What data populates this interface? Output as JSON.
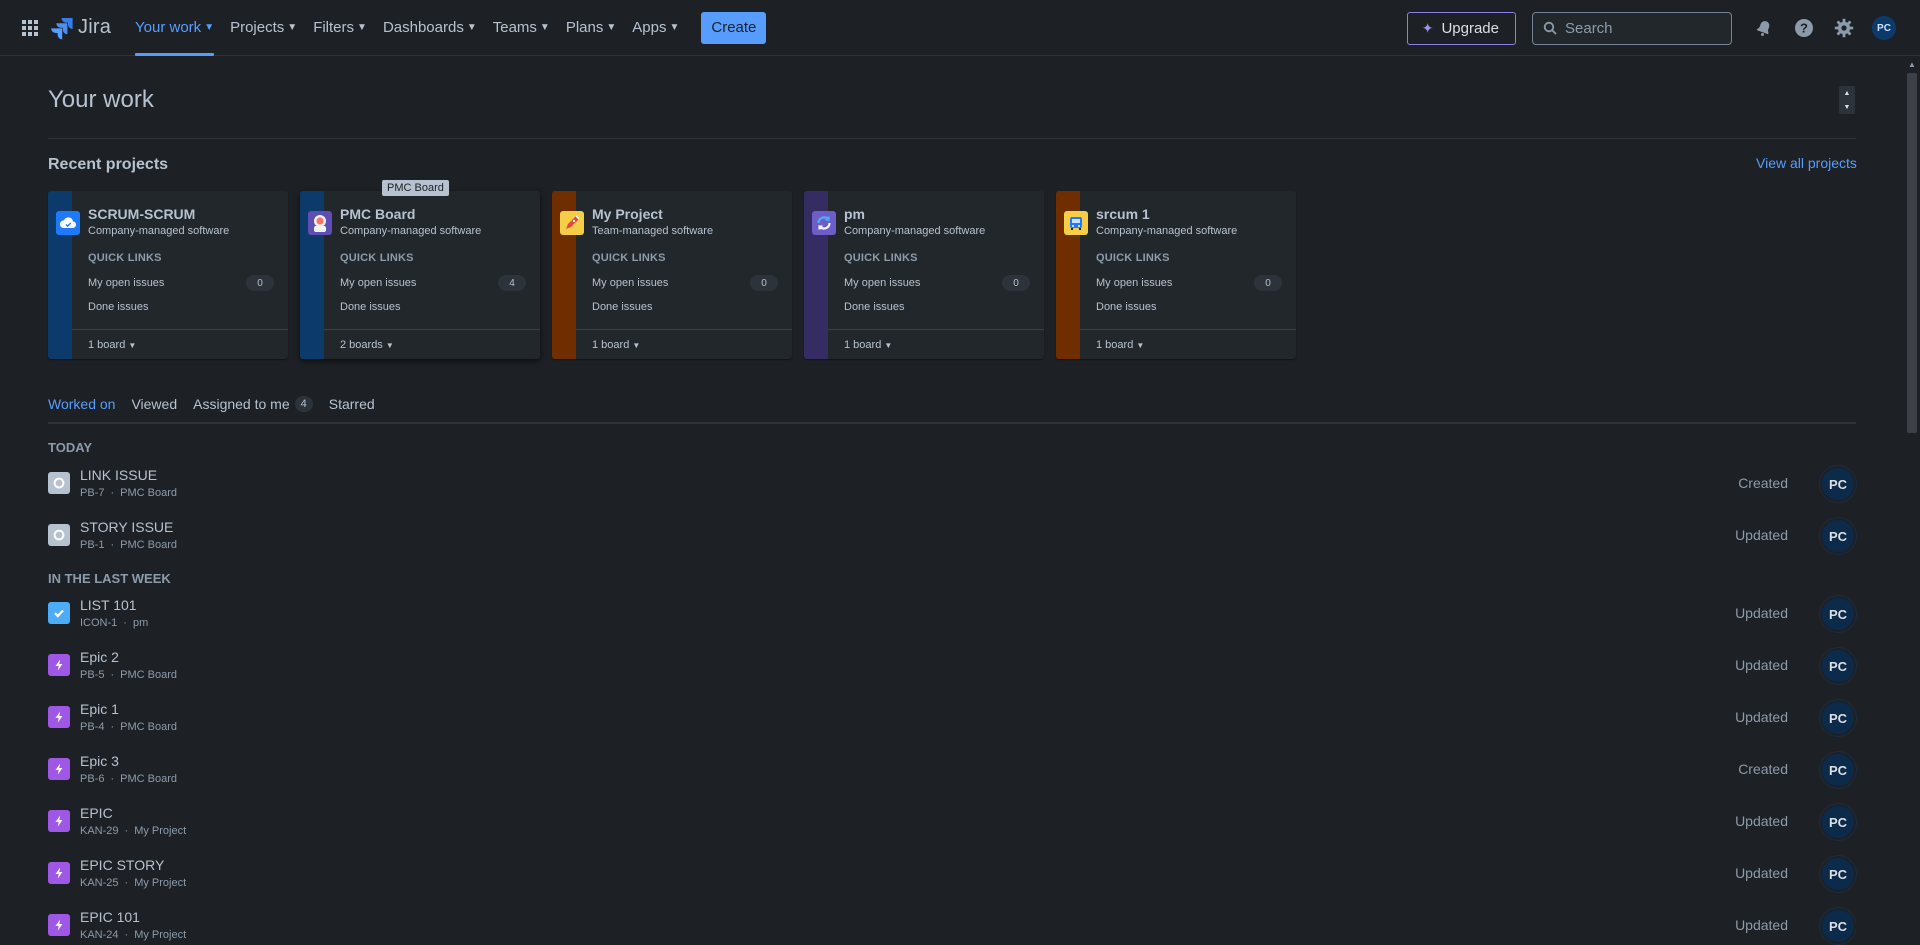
{
  "app": {
    "name": "Jira"
  },
  "nav": {
    "items": [
      {
        "label": "Your work",
        "active": true
      },
      {
        "label": "Projects"
      },
      {
        "label": "Filters"
      },
      {
        "label": "Dashboards"
      },
      {
        "label": "Teams"
      },
      {
        "label": "Plans"
      },
      {
        "label": "Apps"
      }
    ],
    "create_label": "Create",
    "upgrade_label": "Upgrade",
    "search_placeholder": "Search",
    "user_initials": "PC"
  },
  "page": {
    "title": "Your work",
    "recent_projects_heading": "Recent projects",
    "view_all_label": "View all projects",
    "tooltip": "PMC Board"
  },
  "projects": [
    {
      "name": "SCRUM-SCRUM",
      "type": "Company-managed software",
      "quick_links": "QUICK LINKS",
      "open_issues_label": "My open issues",
      "open_count": "0",
      "done_label": "Done issues",
      "boards": "1 board",
      "bar_color": "#0c3a6b",
      "icon": "cloud-icon",
      "icon_bg": "#1d7afc"
    },
    {
      "name": "PMC Board",
      "type": "Company-managed software",
      "quick_links": "QUICK LINKS",
      "open_issues_label": "My open issues",
      "open_count": "4",
      "done_label": "Done issues",
      "boards": "2 boards",
      "bar_color": "#0c3a6b",
      "icon": "astronaut-icon",
      "icon_bg": "#e9ecef"
    },
    {
      "name": "My Project",
      "type": "Team-managed software",
      "quick_links": "QUICK LINKS",
      "open_issues_label": "My open issues",
      "open_count": "0",
      "done_label": "Done issues",
      "boards": "1 board",
      "bar_color": "#702e00",
      "icon": "rocket-icon",
      "icon_bg": "#f5cd47"
    },
    {
      "name": "pm",
      "type": "Company-managed software",
      "quick_links": "QUICK LINKS",
      "open_issues_label": "My open issues",
      "open_count": "0",
      "done_label": "Done issues",
      "boards": "1 board",
      "bar_color": "#352c63",
      "icon": "sync-icon",
      "icon_bg": "#6e5dc6"
    },
    {
      "name": "srcum 1",
      "type": "Company-managed software",
      "quick_links": "QUICK LINKS",
      "open_issues_label": "My open issues",
      "open_count": "0",
      "done_label": "Done issues",
      "boards": "1 board",
      "bar_color": "#702e00",
      "icon": "bus-icon",
      "icon_bg": "#f5cd47"
    }
  ],
  "tabs": [
    {
      "label": "Worked on",
      "active": true
    },
    {
      "label": "Viewed"
    },
    {
      "label": "Assigned to me",
      "count": "4"
    },
    {
      "label": "Starred"
    }
  ],
  "groups": [
    {
      "heading": "TODAY",
      "items": [
        {
          "title": "LINK ISSUE",
          "key": "PB-7",
          "project": "PMC Board",
          "action": "Created",
          "type": "subtask",
          "avatar": "PC"
        },
        {
          "title": "STORY ISSUE",
          "key": "PB-1",
          "project": "PMC Board",
          "action": "Updated",
          "type": "subtask",
          "avatar": "PC"
        }
      ]
    },
    {
      "heading": "IN THE LAST WEEK",
      "items": [
        {
          "title": "LIST 101",
          "key": "ICON-1",
          "project": "pm",
          "action": "Updated",
          "type": "task",
          "avatar": "PC"
        },
        {
          "title": "Epic 2",
          "key": "PB-5",
          "project": "PMC Board",
          "action": "Updated",
          "type": "epic",
          "avatar": "PC"
        },
        {
          "title": "Epic 1",
          "key": "PB-4",
          "project": "PMC Board",
          "action": "Updated",
          "type": "epic",
          "avatar": "PC"
        },
        {
          "title": "Epic 3",
          "key": "PB-6",
          "project": "PMC Board",
          "action": "Created",
          "type": "epic",
          "avatar": "PC"
        },
        {
          "title": "EPIC",
          "key": "KAN-29",
          "project": "My Project",
          "action": "Updated",
          "type": "epic",
          "avatar": "PC"
        },
        {
          "title": "EPIC STORY",
          "key": "KAN-25",
          "project": "My Project",
          "action": "Updated",
          "type": "epic",
          "avatar": "PC"
        },
        {
          "title": "EPIC 101",
          "key": "KAN-24",
          "project": "My Project",
          "action": "Updated",
          "type": "epic",
          "avatar": "PC"
        }
      ]
    }
  ],
  "colors": {
    "accent": "#579dff",
    "background": "#1d2125",
    "epic": "#9f57e6",
    "task": "#4cacf8",
    "subtask": "#b6c2cf"
  }
}
